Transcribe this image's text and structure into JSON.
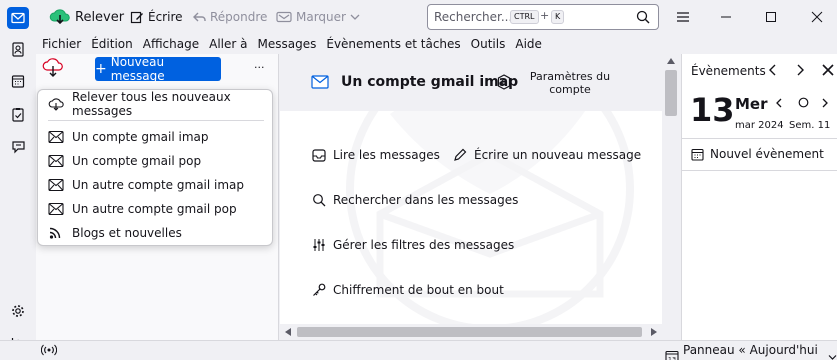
{
  "toolbar": {
    "get_messages": "Relever",
    "write": "Écrire",
    "reply": "Répondre",
    "tag": "Marquer",
    "search_placeholder": "Rechercher...",
    "kbd_ctrl": "CTRL",
    "kbd_plus": "+",
    "kbd_k": "K"
  },
  "menubar": [
    "Fichier",
    "Édition",
    "Affichage",
    "Aller à",
    "Messages",
    "Évènements et tâches",
    "Outils",
    "Aide"
  ],
  "folderpane": {
    "new_message": "Nouveau message",
    "more": "···"
  },
  "popup": {
    "items": [
      {
        "label": "Relever tous les nouveaux messages",
        "icon": "cloud-download-icon"
      },
      {
        "label": "Un compte gmail imap",
        "icon": "mail-account-icon"
      },
      {
        "label": "Un compte gmail pop",
        "icon": "mail-account-icon"
      },
      {
        "label": "Un autre compte gmail imap",
        "icon": "mail-account-icon"
      },
      {
        "label": "Un autre compte gmail pop",
        "icon": "mail-account-icon"
      },
      {
        "label": "Blogs et nouvelles",
        "icon": "rss-icon"
      }
    ]
  },
  "main": {
    "account_title": "Un compte gmail imap",
    "settings_line1": "Paramètres du",
    "settings_line2": "compte",
    "actions": [
      {
        "label": "Lire les messages",
        "icon": "inbox-icon"
      },
      {
        "label": "Écrire un nouveau message",
        "icon": "pencil-icon"
      },
      {
        "label": "Rechercher dans les messages",
        "icon": "search-icon"
      },
      {
        "label": "Gérer les filtres des messages",
        "icon": "filter-icon"
      },
      {
        "label": "Chiffrement de bout en bout",
        "icon": "key-icon"
      }
    ]
  },
  "today": {
    "header": "Évènements",
    "day": "13",
    "weekday": "Mer",
    "month_year": "mar 2024",
    "week": "Sem. 11",
    "new_event": "Nouvel évènement"
  },
  "status": {
    "today_pane": "Panneau « Aujourd'hui »"
  },
  "colors": {
    "accent": "#0060df",
    "bg": "#f0f0f4"
  }
}
